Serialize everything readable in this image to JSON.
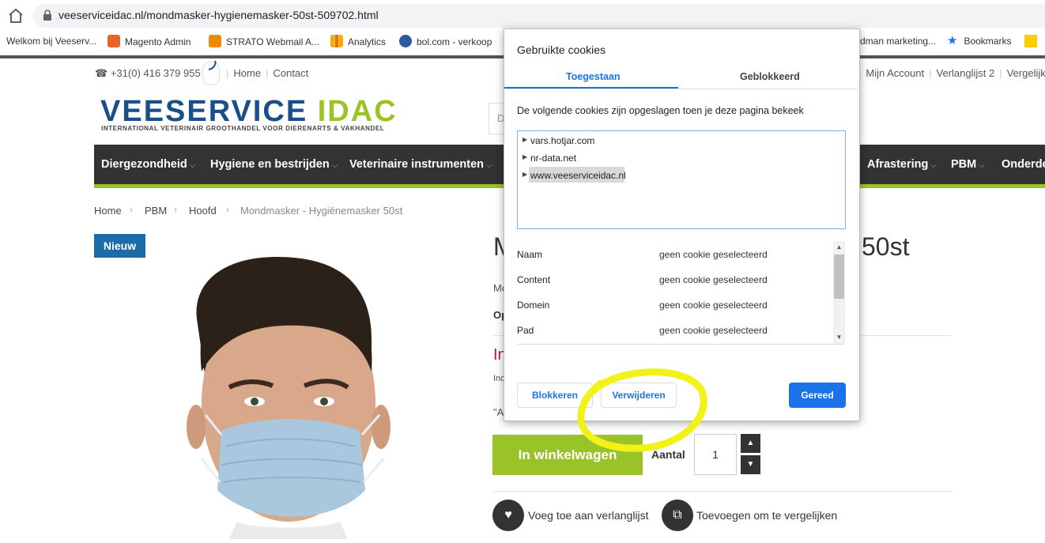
{
  "browser": {
    "url": "veeserviceidac.nl/mondmasker-hygienemasker-50st-509702.html",
    "bookmarks": [
      {
        "label": "Welkom bij Veeserv...",
        "icon": "page-icon"
      },
      {
        "label": "Magento Admin",
        "icon": "magento-icon"
      },
      {
        "label": "STRATO Webmail A...",
        "icon": "mail-icon"
      },
      {
        "label": "Analytics",
        "icon": "analytics-icon"
      },
      {
        "label": "bol.com - verkoop",
        "icon": "globe-icon"
      },
      {
        "label": "dman marketing...",
        "icon": ""
      },
      {
        "label": "Bookmarks",
        "icon": "star-icon"
      }
    ]
  },
  "site": {
    "phone": "+31(0) 416 379 955",
    "top_links": [
      "Home",
      "Contact"
    ],
    "account_links": [
      "Mijn Account",
      "Verlanglijst 2",
      "Vergelijk"
    ],
    "logo_main": "VEESERVICE",
    "logo_accent": "IDAC",
    "logo_tagline": "INTERNATIONAL VETERINAIR GROOTHANDEL VOOR DIERENARTS & VAKHANDEL",
    "search_fragment": "D",
    "nav": [
      "Diergezondheid",
      "Hygiene en bestrijden",
      "Veterinaire instrumenten",
      "Afrastering",
      "PBM",
      "Onderde"
    ],
    "breadcrumb": [
      "Home",
      "PBM",
      "Hoofd",
      "Mondmasker - Hygiënemasker 50st"
    ],
    "badge": "Nieuw",
    "title_start": "M",
    "title_end": "50st",
    "frag_mo": "Mo",
    "frag_op": "Op",
    "frag_in": "In",
    "frag_inc": "Inc",
    "frag_quote": "\"A",
    "cart_button": "In winkelwagen",
    "qty_label": "Aantal",
    "qty_value": "1",
    "wishlist": "Voeg toe aan verlanglijst",
    "compare": "Toevoegen om te vergelijken"
  },
  "dialog": {
    "title": "Gebruikte cookies",
    "tab_allowed": "Toegestaan",
    "tab_blocked": "Geblokkeerd",
    "description": "De volgende cookies zijn opgeslagen toen je deze pagina bekeek",
    "domains": [
      "vars.hotjar.com",
      "nr-data.net",
      "www.veeserviceidac.nl"
    ],
    "details": [
      {
        "label": "Naam",
        "value": "geen cookie geselecteerd"
      },
      {
        "label": "Content",
        "value": "geen cookie geselecteerd"
      },
      {
        "label": "Domein",
        "value": "geen cookie geselecteerd"
      },
      {
        "label": "Pad",
        "value": "geen cookie geselecteerd"
      }
    ],
    "btn_block": "Blokkeren",
    "btn_remove": "Verwijderen",
    "btn_done": "Gereed"
  },
  "colors": {
    "brand_blue": "#1b4f8a",
    "brand_green": "#9ac327",
    "dialog_blue": "#1a73e8",
    "annotation_yellow": "#f2f21a"
  }
}
